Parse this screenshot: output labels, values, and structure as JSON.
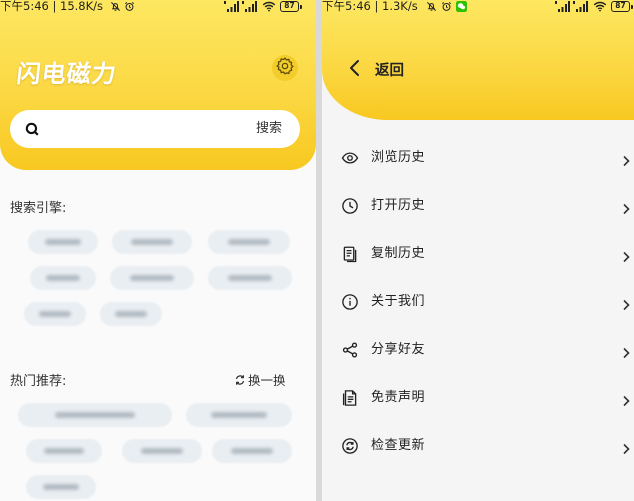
{
  "left_screen": {
    "status_bar": {
      "time_speed": "下午5:46 | 15.8K/s",
      "battery": "87"
    },
    "header": {
      "app_title": "闪电磁力"
    },
    "search": {
      "button_label": "搜索"
    },
    "engines": {
      "title": "搜索引擎:"
    },
    "hot": {
      "title": "热门推荐:",
      "refresh_label": "换一换"
    }
  },
  "right_screen": {
    "status_bar": {
      "time_speed": "下午5:46 | 1.3K/s",
      "battery": "87"
    },
    "header": {
      "back_label": "返回"
    },
    "menu": [
      {
        "label": "浏览历史",
        "icon": "eye-icon"
      },
      {
        "label": "打开历史",
        "icon": "clock-icon"
      },
      {
        "label": "复制历史",
        "icon": "copy-document-icon"
      },
      {
        "label": "关于我们",
        "icon": "info-icon"
      },
      {
        "label": "分享好友",
        "icon": "share-icon"
      },
      {
        "label": "免责声明",
        "icon": "disclaimer-document-icon"
      },
      {
        "label": "检查更新",
        "icon": "refresh-update-icon"
      }
    ]
  },
  "colors": {
    "header_yellow_light": "#fde761",
    "header_yellow_dark": "#f8c820",
    "wechat_green": "#2dc100",
    "text": "#222222"
  }
}
